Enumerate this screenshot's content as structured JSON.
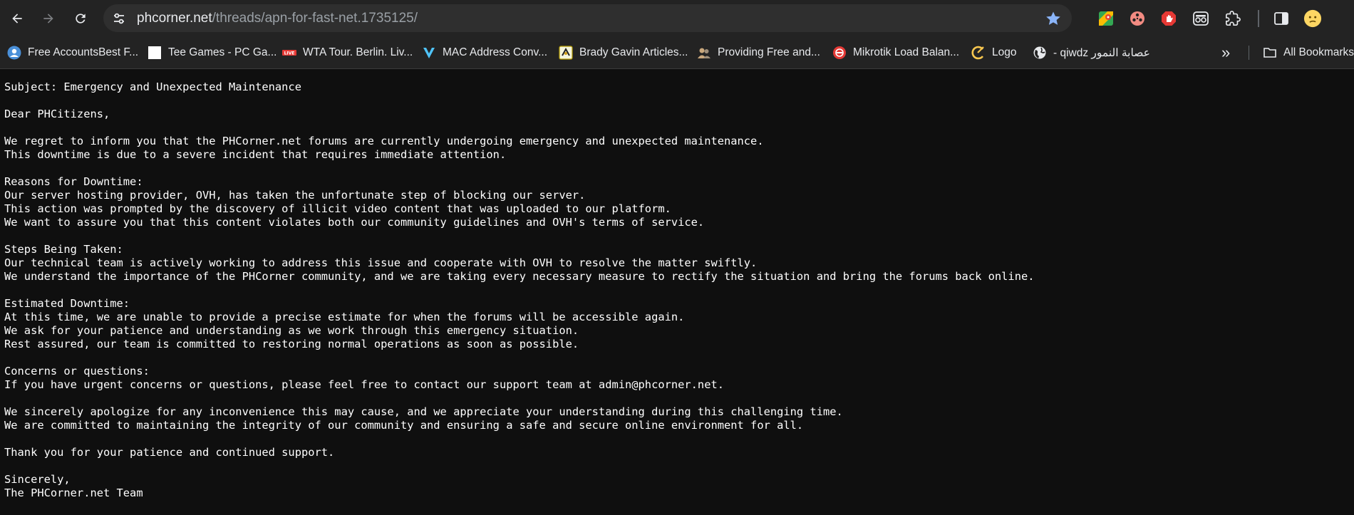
{
  "browser": {
    "url_host": "phcorner.net",
    "url_path": "/threads/apn-for-fast-net.1735125/",
    "icons": {
      "back": "arrow-left-icon",
      "forward": "arrow-right-icon",
      "reload": "reload-icon",
      "site_info": "tune-icon",
      "bookmark_star": "star-icon",
      "extensions": "puzzle-icon",
      "side_panel": "side-panel-icon",
      "profile": "profile-avatar-icon"
    },
    "colors": {
      "toolbar_bg": "#232323",
      "omnibox_bg": "#2f2f2f",
      "star": "#8ab4f8",
      "page_bg": "#0f0f0f"
    }
  },
  "bookmarks": {
    "items": [
      {
        "label": "Free AccountsBest F..."
      },
      {
        "label": "Tee Games - PC Ga..."
      },
      {
        "label": "WTA Tour. Berlin. Liv..."
      },
      {
        "label": "MAC Address Conv..."
      },
      {
        "label": "Brady Gavin Articles..."
      },
      {
        "label": "Providing Free and..."
      },
      {
        "label": "Mikrotik Load Balan..."
      },
      {
        "label": "Logo"
      },
      {
        "label": "- qiwdz عصابة النمور"
      }
    ],
    "overflow_label": "»",
    "all_bookmarks_label": "All Bookmarks"
  },
  "message": {
    "lines": [
      "Subject: Emergency and Unexpected Maintenance",
      "",
      "Dear PHCitizens,",
      "",
      "We regret to inform you that the PHCorner.net forums are currently undergoing emergency and unexpected maintenance.",
      "This downtime is due to a severe incident that requires immediate attention.",
      "",
      "Reasons for Downtime:",
      "Our server hosting provider, OVH, has taken the unfortunate step of blocking our server.",
      "This action was prompted by the discovery of illicit video content that was uploaded to our platform.",
      "We want to assure you that this content violates both our community guidelines and OVH's terms of service.",
      "",
      "Steps Being Taken:",
      "Our technical team is actively working to address this issue and cooperate with OVH to resolve the matter swiftly.",
      "We understand the importance of the PHCorner community, and we are taking every necessary measure to rectify the situation and bring the forums back online.",
      "",
      "Estimated Downtime:",
      "At this time, we are unable to provide a precise estimate for when the forums will be accessible again.",
      "We ask for your patience and understanding as we work through this emergency situation.",
      "Rest assured, our team is committed to restoring normal operations as soon as possible.",
      "",
      "Concerns or questions:",
      "If you have urgent concerns or questions, please feel free to contact our support team at admin@phcorner.net.",
      "",
      "We sincerely apologize for any inconvenience this may cause, and we appreciate your understanding during this challenging time.",
      "We are committed to maintaining the integrity of our community and ensuring a safe and secure online environment for all.",
      "",
      "Thank you for your patience and continued support.",
      "",
      "Sincerely,",
      "The PHCorner.net Team"
    ]
  }
}
